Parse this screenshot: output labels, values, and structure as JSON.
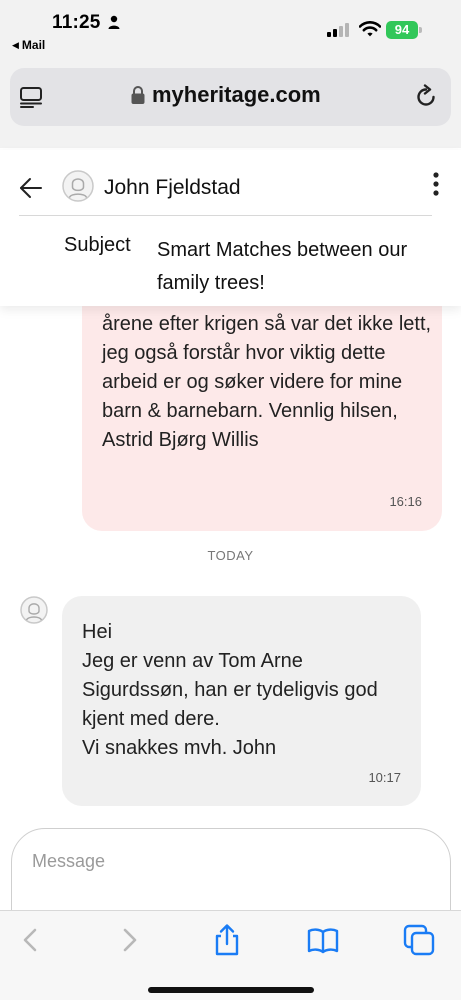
{
  "status_bar": {
    "time": "11:25",
    "back_app": "Mail",
    "battery": "94"
  },
  "browser": {
    "url": "myheritage.com"
  },
  "conversation": {
    "contact_name": "John Fjeldstad",
    "subject_label": "Subject",
    "subject_value": "Smart Matches between our family trees!"
  },
  "messages": {
    "outgoing": {
      "text": "årene efter krigen så var det ikke lett, jeg også forstår hvor viktig dette arbeid er og søker videre for mine barn & barnebarn. Vennlig hilsen, Astrid Bjørg Willis",
      "time": "16:16"
    },
    "day_separator": "TODAY",
    "incoming": {
      "text": "Hei\nJeg er venn av Tom Arne Sigurdssøn, han er tydeligvis god kjent med dere.\nVi snakkes mvh. John",
      "time": "10:17"
    }
  },
  "compose": {
    "placeholder": "Message",
    "value": ""
  },
  "colors": {
    "outgoing_bubble": "#fde9e9",
    "incoming_bubble": "#f0f0f0",
    "ios_blue": "#1a7cf5",
    "battery_green": "#31c759"
  },
  "icons": {
    "status": [
      "person-icon",
      "signal-icon",
      "wifi-icon",
      "battery-icon"
    ],
    "browser": [
      "reader-icon",
      "lock-icon",
      "reload-icon"
    ],
    "header": [
      "back-arrow-icon",
      "avatar-icon",
      "more-icon"
    ],
    "toolbar": [
      "back-icon",
      "forward-icon",
      "share-icon",
      "bookmarks-icon",
      "tabs-icon"
    ]
  }
}
